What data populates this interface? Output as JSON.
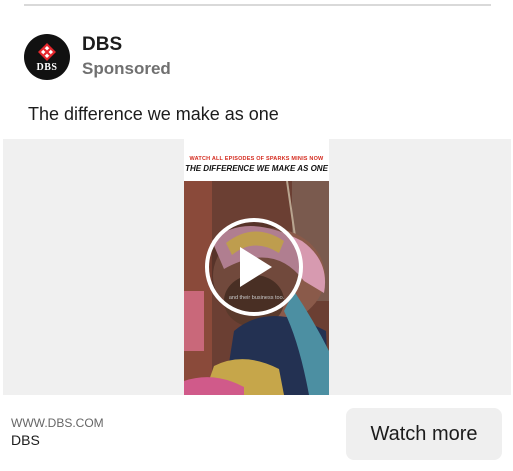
{
  "advertiser": {
    "name": "DBS",
    "label": "Sponsored",
    "logo_text": "DBS",
    "logo_icon": "dbs-logo-icon"
  },
  "post": {
    "caption": "The difference we make as one"
  },
  "video": {
    "banner_line1": "WATCH ALL EPISODES OF SPARKS MINIS NOW",
    "banner_line2": "THE DIFFERENCE WE MAKE AS ONE",
    "subtitle": "and their business too.",
    "play_icon": "play-icon"
  },
  "footer": {
    "domain": "WWW.DBS.COM",
    "title": "DBS",
    "cta_label": "Watch more"
  },
  "colors": {
    "brand_red": "#d42b1f",
    "cta_background": "#efefef",
    "media_background": "#f0f0f0"
  }
}
